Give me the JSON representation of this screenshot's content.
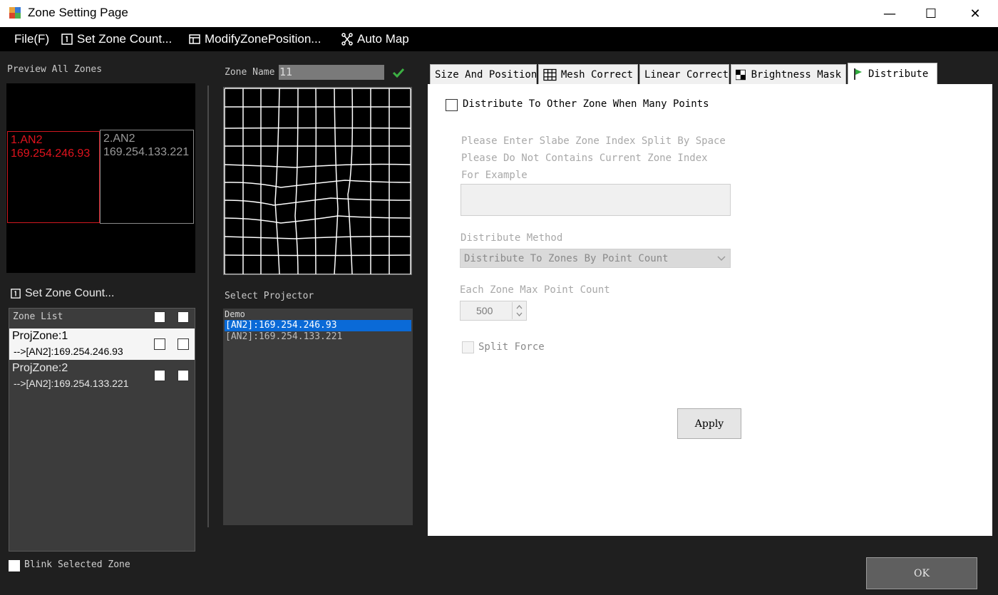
{
  "window": {
    "title": "Zone Setting Page",
    "minimize": "—",
    "maximize": "☐",
    "close": "✕"
  },
  "menu": {
    "file": "File(F)",
    "set_zone_count": "Set Zone Count...",
    "modify_zone_position": "ModifyZonePosition...",
    "auto_map": "Auto Map"
  },
  "preview": {
    "label": "Preview All Zones",
    "zones": [
      {
        "name": "1.AN2",
        "ip": "169.254.246.93",
        "color": "#e0131d"
      },
      {
        "name": "2.AN2",
        "ip": "169.254.133.221",
        "color": "#9a9a9a"
      }
    ]
  },
  "left": {
    "set_zone_count": "Set Zone Count...",
    "zone_list_header": "Zone List",
    "zones": [
      {
        "title": "ProjZone:1",
        "detail": "-->[AN2]:169.254.246.93",
        "selected": true
      },
      {
        "title": "ProjZone:2",
        "detail": "-->[AN2]:169.254.133.221",
        "selected": false
      }
    ],
    "blink_label": "Blink Selected Zone"
  },
  "middle": {
    "zone_name_label": "Zone Name",
    "zone_name_value": "11",
    "select_projector_label": "Select Projector",
    "projectors": [
      {
        "text": "Demo",
        "selected": false
      },
      {
        "text": "[AN2]:169.254.246.93",
        "selected": true
      },
      {
        "text": "[AN2]:169.254.133.221",
        "selected": false
      }
    ]
  },
  "tabs": [
    {
      "label": "Size And Position",
      "icon": "",
      "active": false
    },
    {
      "label": "Mesh Correct",
      "icon": "grid-icon",
      "active": false
    },
    {
      "label": "Linear Correct",
      "icon": "",
      "active": false
    },
    {
      "label": "Brightness Mask",
      "icon": "checker-icon",
      "active": false
    },
    {
      "label": "Distribute",
      "icon": "flag-icon",
      "active": true
    }
  ],
  "distribute": {
    "enable_label": "Distribute To Other Zone When Many Points",
    "hint1": "Please Enter Slabe Zone Index Split By Space",
    "hint2": "Please Do Not Contains Current Zone Index",
    "hint3": "For Example",
    "method_label": "Distribute Method",
    "method_value": "Distribute To Zones By Point Count",
    "max_label": "Each Zone Max Point Count",
    "max_value": "500",
    "split_force": "Split Force",
    "apply": "Apply"
  },
  "ok": "OK"
}
